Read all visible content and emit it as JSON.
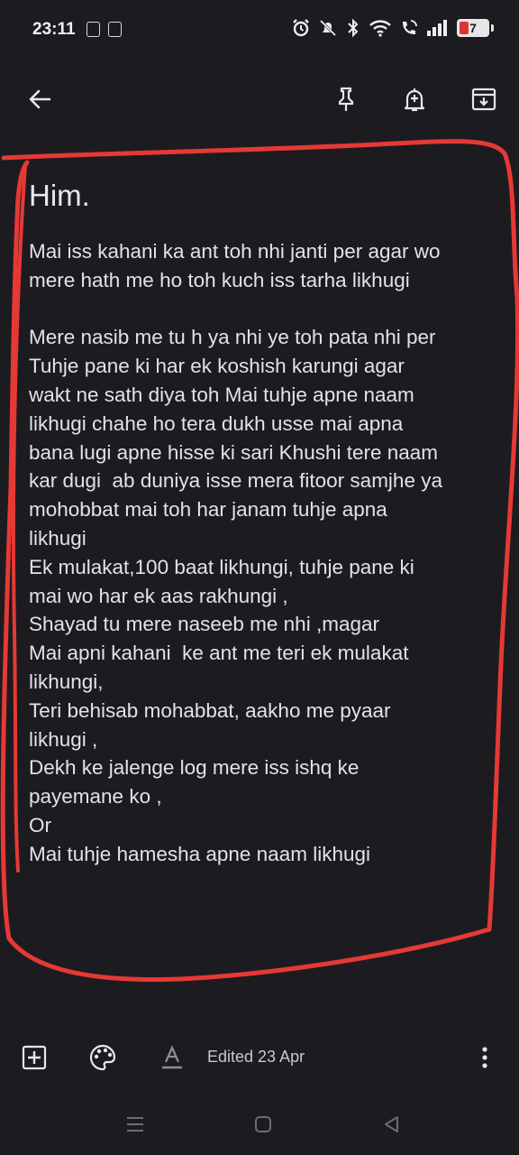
{
  "status_bar": {
    "time": "23:11",
    "battery": "7",
    "icons": [
      "pdf-icon",
      "calculator-icon",
      "alarm-icon",
      "mute-icon",
      "bluetooth-icon",
      "wifi-icon",
      "wifi-call-icon",
      "signal-icon",
      "battery-icon"
    ],
    "battery_color": "#d33333"
  },
  "toolbar": {
    "icons": [
      "back-arrow-icon",
      "pin-icon",
      "reminder-bell-icon",
      "archive-icon"
    ]
  },
  "note": {
    "title": "Him.",
    "lines": [
      "Mai iss kahani ka ant toh nhi janti per agar wo",
      "mere hath me ho toh kuch iss tarha likhugi",
      "",
      "Mere nasib me tu h ya nhi ye toh pata nhi per",
      "Tuhje pane ki har ek koshish karungi agar",
      "wakt ne sath diya toh Mai tuhje apne naam",
      "likhugi chahe ho tera dukh usse mai apna",
      "bana lugi apne hisse ki sari Khushi tere naam",
      "kar dugi  ab duniya isse mera fitoor samjhe ya",
      "mohobbat mai toh har janam tuhje apna",
      "likhugi",
      "Ek mulakat,100 baat likhungi, tuhje pane ki",
      "mai wo har ek aas rakhungi ,",
      "Shayad tu mere naseeb me nhi ,magar",
      "Mai apni kahani  ke ant me teri ek mulakat",
      "likhungi,",
      "Teri behisab mohabbat, aakho me pyaar",
      "likhugi ,",
      "Dekh ke jalenge log mere iss ishq ke",
      "payemane ko ,",
      "Or",
      "Mai tuhje hamesha apne naam likhugi"
    ]
  },
  "bottom_bar": {
    "edited": "Edited 23 Apr",
    "icons": [
      "add-box-icon",
      "palette-icon",
      "text-format-icon",
      "more-vert-icon"
    ]
  },
  "nav_bar": {
    "icons": [
      "recents-icon",
      "home-icon",
      "back-icon"
    ]
  },
  "colors": {
    "background": "#1c1b20",
    "text": "#e4e2e6",
    "annotation": "#e53935"
  }
}
